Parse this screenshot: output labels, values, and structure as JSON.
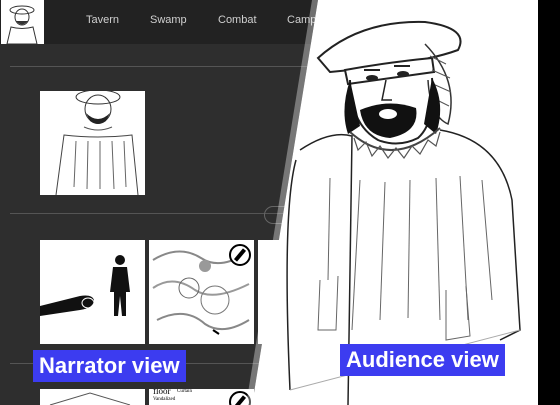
{
  "nav": {
    "items": [
      "Tavern",
      "Swamp",
      "Combat",
      "Camp"
    ]
  },
  "labels": {
    "narrator": "Narrator view",
    "audience": "Audience view"
  },
  "map_snippet": {
    "word_floor": "floor",
    "word_curtain": "Curtain",
    "word_vandalized": "Vandalized"
  },
  "colors": {
    "label_bg": "#3c3cf0",
    "narrator_bg": "#2e2e2e",
    "navbar_bg": "#222222"
  },
  "icons": [
    "portrait-icon",
    "compass-icon"
  ]
}
